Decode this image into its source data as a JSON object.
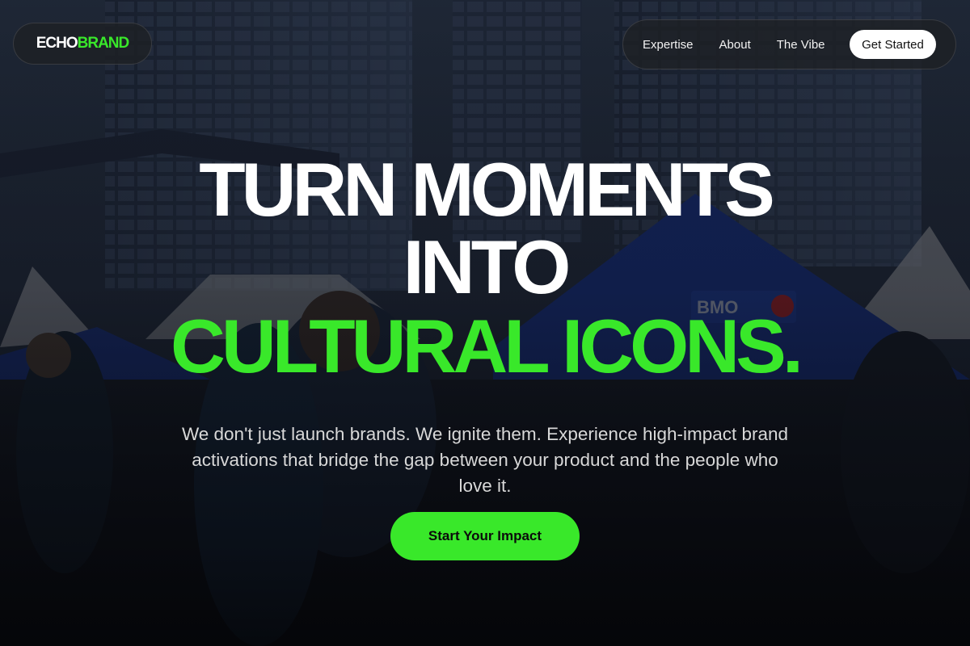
{
  "nav": {
    "logo": {
      "part1": "ECHO",
      "part2": "BRAND"
    },
    "links": [
      "Expertise",
      "About",
      "The Vibe"
    ],
    "cta_label": "Get Started"
  },
  "hero": {
    "headline_line1": "TURN MOMENTS",
    "headline_line2": "INTO",
    "headline_line3": "CULTURAL ICONS.",
    "subtext": "We don't just launch brands. We ignite them. Experience high-impact brand activations that bridge the gap between your product and the people who love it.",
    "cta_label": "Start Your Impact"
  },
  "background": {
    "sign_text": "BMO"
  },
  "colors": {
    "accent": "#39e82a",
    "text": "#ffffff",
    "pill_bg": "#1e2024"
  }
}
